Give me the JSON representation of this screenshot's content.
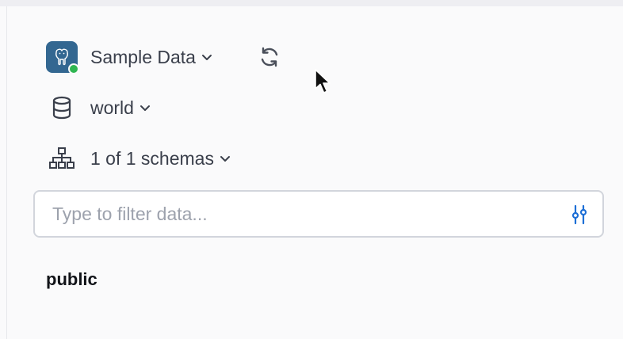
{
  "connection": {
    "name": "Sample Data",
    "status_color": "#2fb551",
    "logo_icon": "postgresql-elephant-icon",
    "refresh_icon": "refresh-icon"
  },
  "database": {
    "name": "world",
    "icon": "database-icon"
  },
  "schemas": {
    "summary": "1 of 1 schemas",
    "icon": "hierarchy-icon"
  },
  "filter": {
    "value": "",
    "placeholder": "Type to filter data...",
    "icon": "filter-sliders-icon"
  },
  "schema_list": [
    {
      "name": "public"
    }
  ],
  "colors": {
    "accent": "#1d6fd6",
    "logo_bg": "#336791"
  }
}
